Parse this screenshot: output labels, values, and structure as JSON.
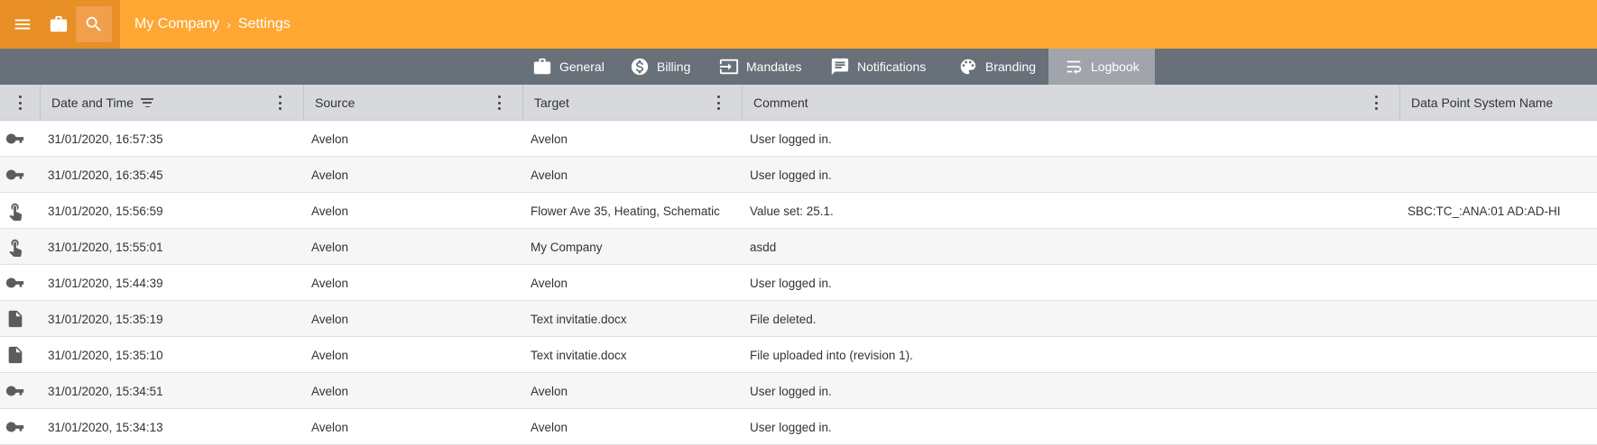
{
  "header": {
    "breadcrumb": [
      "My Company",
      "Settings"
    ],
    "breadcrumb_separator": "›",
    "icons": [
      "menu-icon",
      "briefcase-icon",
      "search-icon"
    ]
  },
  "tabs": [
    {
      "label": "General",
      "icon": "briefcase-icon",
      "active": false
    },
    {
      "label": "Billing",
      "icon": "dollar-circle-icon",
      "active": false
    },
    {
      "label": "Mandates",
      "icon": "arrow-box-icon",
      "active": false
    },
    {
      "label": "Notifications",
      "icon": "chat-icon",
      "active": false
    },
    {
      "label": "Branding",
      "icon": "palette-icon",
      "active": false
    },
    {
      "label": "Logbook",
      "icon": "wrap-text-icon",
      "active": true
    }
  ],
  "table": {
    "columns": [
      "Date and Time",
      "Source",
      "Target",
      "Comment",
      "Data Point System Name"
    ],
    "rows": [
      {
        "icon": "key-icon",
        "datetime": "31/01/2020, 16:57:35",
        "source": "Avelon",
        "target": "Avelon",
        "comment": "User logged in.",
        "dp": ""
      },
      {
        "icon": "key-icon",
        "datetime": "31/01/2020, 16:35:45",
        "source": "Avelon",
        "target": "Avelon",
        "comment": "User logged in.",
        "dp": ""
      },
      {
        "icon": "touch-icon",
        "datetime": "31/01/2020, 15:56:59",
        "source": "Avelon",
        "target": "Flower Ave 35, Heating, Schematic",
        "comment": "Value set: 25.1.",
        "dp": "SBC:TC_:ANA:01 AD:AD-HI"
      },
      {
        "icon": "touch-icon",
        "datetime": "31/01/2020, 15:55:01",
        "source": "Avelon",
        "target": "My Company",
        "comment": "asdd",
        "dp": ""
      },
      {
        "icon": "key-icon",
        "datetime": "31/01/2020, 15:44:39",
        "source": "Avelon",
        "target": "Avelon",
        "comment": "User logged in.",
        "dp": ""
      },
      {
        "icon": "file-icon",
        "datetime": "31/01/2020, 15:35:19",
        "source": "Avelon",
        "target": "Text invitatie.docx",
        "comment": "File deleted.",
        "dp": ""
      },
      {
        "icon": "file-icon",
        "datetime": "31/01/2020, 15:35:10",
        "source": "Avelon",
        "target": "Text invitatie.docx",
        "comment": "File uploaded into (revision 1).",
        "dp": ""
      },
      {
        "icon": "key-icon",
        "datetime": "31/01/2020, 15:34:51",
        "source": "Avelon",
        "target": "Avelon",
        "comment": "User logged in.",
        "dp": ""
      },
      {
        "icon": "key-icon",
        "datetime": "31/01/2020, 15:34:13",
        "source": "Avelon",
        "target": "Avelon",
        "comment": "User logged in.",
        "dp": ""
      }
    ]
  },
  "colors": {
    "topbar": "#ffa733",
    "topbar_left": "#e88f25",
    "tabbar": "#687079",
    "tab_active": "#a0a5ab",
    "table_header": "#d7d9dc"
  }
}
